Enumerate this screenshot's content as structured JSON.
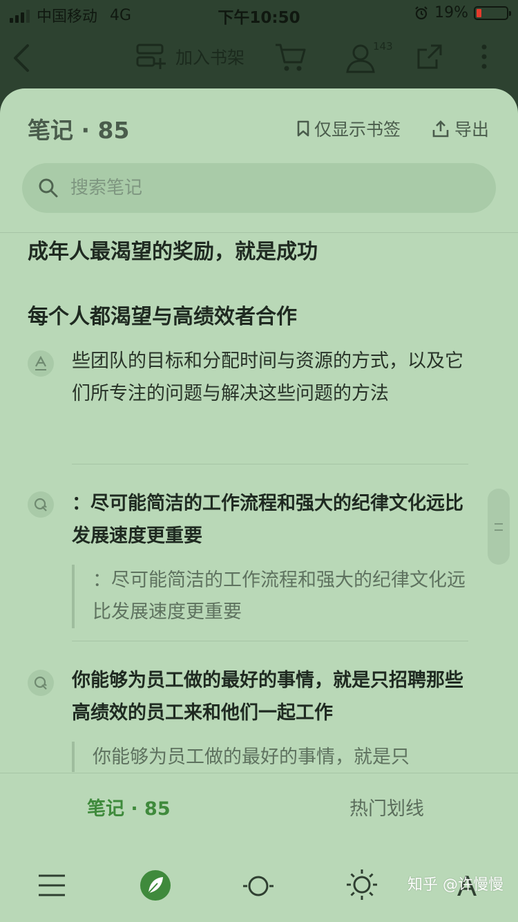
{
  "status_bar": {
    "carrier": "中国移动",
    "network": "4G",
    "time": "下午10:50",
    "battery": "19%",
    "battery_level": 0.19
  },
  "app_bar": {
    "add_to_shelf": "加入书架",
    "badge_count": "143"
  },
  "sheet": {
    "title": "笔记 · 85",
    "bookmark_only": "仅显示书签",
    "export": "导出"
  },
  "search": {
    "placeholder": "搜索笔记"
  },
  "chapters": [
    "成年人最渴望的奖励，就是成功",
    "每个人都渴望与高绩效者合作"
  ],
  "notes": [
    {
      "type": "highlight",
      "text": "些团队的目标和分配时间与资源的方式，以及它们所专注的问题与解决这些问题的方法"
    },
    {
      "type": "thought",
      "text": "：尽可能简洁的工作流程和强大的纪律文化远比发展速度更重要",
      "quote": "：尽可能简洁的工作流程和强大的纪律文化远比发展速度更重要"
    },
    {
      "type": "thought",
      "text": "你能够为员工做的最好的事情，就是只招聘那些高绩效的员工来和他们一起工作",
      "quote": "你能够为员工做的最好的事情，就是只"
    }
  ],
  "tabs": {
    "notes": "笔记 · 85",
    "popular": "热门划线"
  },
  "toolbar_icons": [
    "menu-icon",
    "leaf-icon",
    "progress-icon",
    "brightness-icon",
    "font-icon"
  ],
  "font_icon_glyph": "A",
  "watermark": "知乎 @许慢慢",
  "colors": {
    "sheet_bg": "#b9d8b7",
    "accent": "#3f8a3c",
    "battery_low": "#e53b2c"
  }
}
